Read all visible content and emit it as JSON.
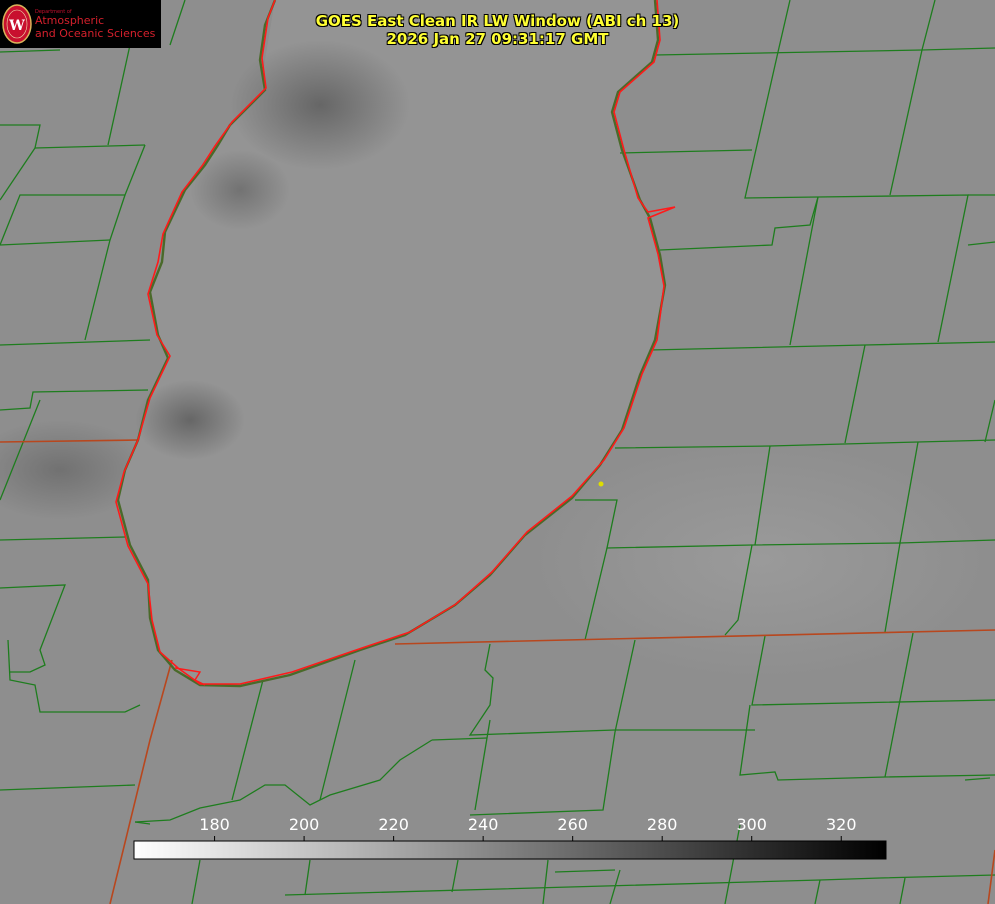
{
  "title": {
    "line1": "GOES East Clean IR LW Window (ABI ch 13)",
    "line2": "2026 Jan 27 09:31:17 GMT"
  },
  "logo": {
    "small_text": "Department of",
    "line1": "Atmospheric",
    "line2": "and Oceanic Sciences",
    "seal_letter": "W"
  },
  "colorbar": {
    "ticks": [
      "180",
      "200",
      "220",
      "240",
      "260",
      "280",
      "300",
      "320"
    ],
    "tick_values": [
      180,
      200,
      220,
      240,
      260,
      280,
      300,
      320
    ],
    "range_min": 162,
    "range_max": 330,
    "low_color": "#ffffff",
    "high_color": "#000000"
  },
  "colors": {
    "county_lines": "#1e7d1e",
    "state_lines": "#b8471e",
    "coastline": "#ff1a1a",
    "title_text": "#ffff33",
    "marker": "#dddd00"
  },
  "icons": {
    "seal": "university-seal-icon",
    "marker": "location-dot-icon"
  }
}
